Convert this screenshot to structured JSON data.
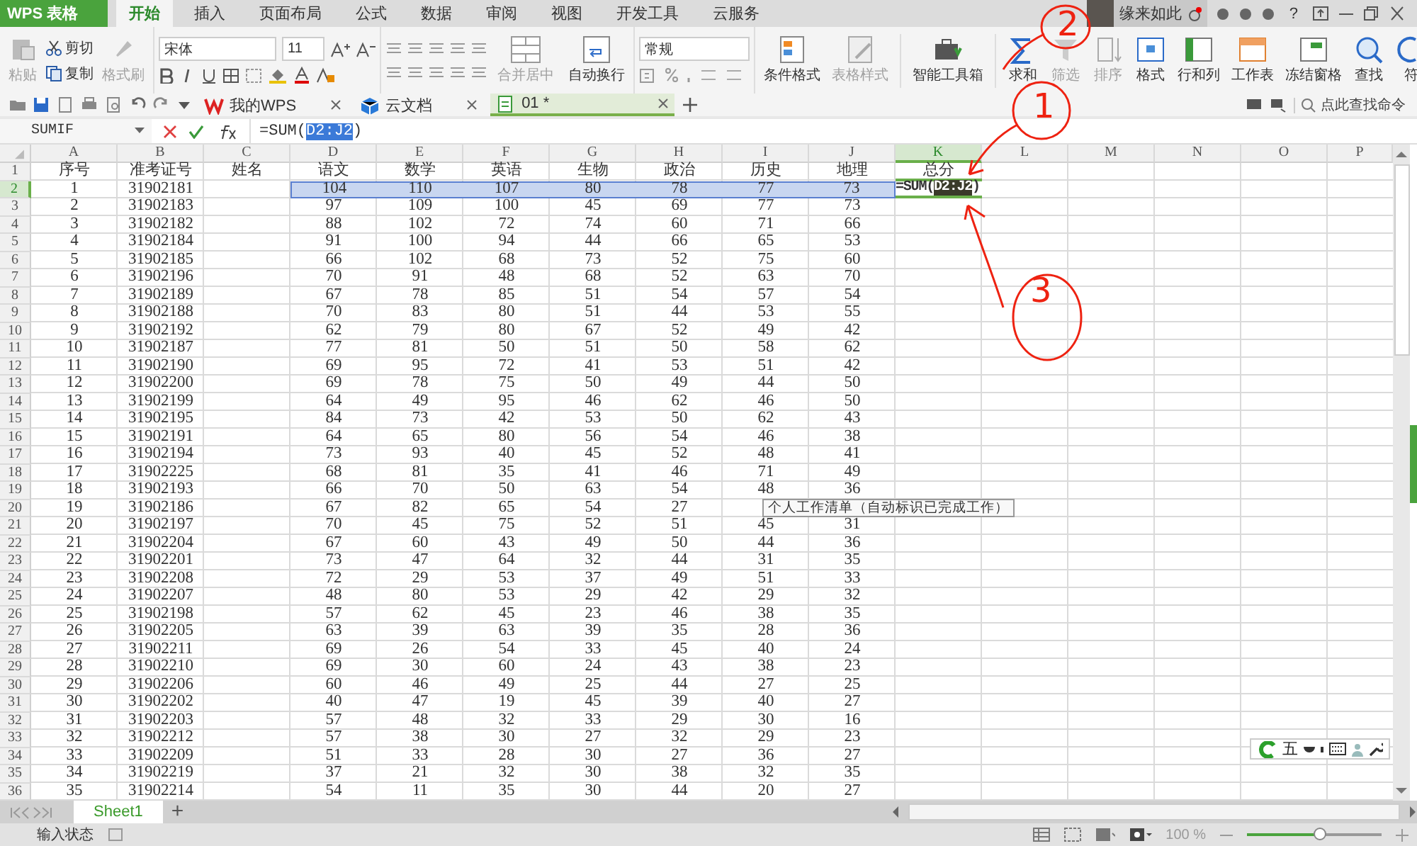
{
  "app_menu": {
    "label": "WPS 表格"
  },
  "tabs": [
    {
      "label": "开始",
      "selected": true
    },
    {
      "label": "插入",
      "selected": false
    },
    {
      "label": "页面布局",
      "selected": false
    },
    {
      "label": "公式",
      "selected": false
    },
    {
      "label": "数据",
      "selected": false
    },
    {
      "label": "审阅",
      "selected": false
    },
    {
      "label": "视图",
      "selected": false
    },
    {
      "label": "开发工具",
      "selected": false
    },
    {
      "label": "云服务",
      "selected": false
    }
  ],
  "user": {
    "name": "缘来如此",
    "help": "?"
  },
  "ribbon": {
    "clipboard": [
      {
        "label": "粘贴",
        "disabled": true
      },
      {
        "label": "剪切",
        "disabled": false
      },
      {
        "label": "复制",
        "disabled": false
      },
      {
        "label": "格式刷",
        "disabled": true
      }
    ],
    "font": {
      "name": "宋体",
      "size": "11"
    },
    "align": [
      {
        "label": "合并居中",
        "disabled": true
      },
      {
        "label": "自动换行",
        "disabled": false
      }
    ],
    "number_format": "常规",
    "big_buttons": [
      {
        "label": "条件格式",
        "disabled": false
      },
      {
        "label": "表格样式",
        "disabled": true
      },
      {
        "label": "智能工具箱",
        "disabled": false
      },
      {
        "label": "求和",
        "disabled": false
      },
      {
        "label": "筛选",
        "disabled": true
      },
      {
        "label": "排序",
        "disabled": true
      },
      {
        "label": "格式",
        "disabled": false
      },
      {
        "label": "行和列",
        "disabled": false
      },
      {
        "label": "工作表",
        "disabled": false
      },
      {
        "label": "冻结窗格",
        "disabled": false
      },
      {
        "label": "查找",
        "disabled": false
      },
      {
        "label": "符",
        "disabled": false
      }
    ]
  },
  "doc_tabs": [
    {
      "label": "我的WPS",
      "selected": false
    },
    {
      "label": "云文档",
      "selected": false
    },
    {
      "label": "01 *",
      "selected": true
    }
  ],
  "command_search": {
    "placeholder": "点此查找命令"
  },
  "formula_bar": {
    "name_box": "SUMIF",
    "formula_prefix": "=SUM(",
    "formula_ref": "D2:J2",
    "formula_suffix": ")"
  },
  "active_cell": {
    "prefix": "=SUM(",
    "ref": "D2:J2",
    "suffix": ")"
  },
  "sheet": {
    "columns": [
      {
        "label": "A",
        "selected": false
      },
      {
        "label": "B",
        "selected": false
      },
      {
        "label": "C",
        "selected": false
      },
      {
        "label": "D",
        "selected": false
      },
      {
        "label": "E",
        "selected": false
      },
      {
        "label": "F",
        "selected": false
      },
      {
        "label": "G",
        "selected": false
      },
      {
        "label": "H",
        "selected": false
      },
      {
        "label": "I",
        "selected": false
      },
      {
        "label": "J",
        "selected": false
      },
      {
        "label": "K",
        "selected": true
      },
      {
        "label": "L",
        "selected": false
      },
      {
        "label": "M",
        "selected": false
      },
      {
        "label": "N",
        "selected": false
      },
      {
        "label": "O",
        "selected": false
      },
      {
        "label": "P",
        "selected": false
      }
    ],
    "rows": [
      {
        "number": "1",
        "selected": false,
        "referenced": false,
        "cells": [
          "序号",
          "准考证号",
          "姓名",
          "语文",
          "数学",
          "英语",
          "生物",
          "政治",
          "历史",
          "地理",
          "总分"
        ]
      },
      {
        "number": "2",
        "selected": true,
        "referenced": true,
        "cells": [
          "1",
          "31902181",
          null,
          "104",
          "110",
          "107",
          "80",
          "78",
          "77",
          "73"
        ]
      },
      {
        "number": "3",
        "selected": false,
        "referenced": false,
        "cells": [
          "2",
          "31902183",
          null,
          "97",
          "109",
          "100",
          "45",
          "69",
          "77",
          "73"
        ]
      },
      {
        "number": "4",
        "selected": false,
        "referenced": false,
        "cells": [
          "3",
          "31902182",
          null,
          "88",
          "102",
          "72",
          "74",
          "60",
          "71",
          "66"
        ]
      },
      {
        "number": "5",
        "selected": false,
        "referenced": false,
        "cells": [
          "4",
          "31902184",
          null,
          "91",
          "100",
          "94",
          "44",
          "66",
          "65",
          "53"
        ]
      },
      {
        "number": "6",
        "selected": false,
        "referenced": false,
        "cells": [
          "5",
          "31902185",
          null,
          "66",
          "102",
          "68",
          "73",
          "52",
          "75",
          "60"
        ]
      },
      {
        "number": "7",
        "selected": false,
        "referenced": false,
        "cells": [
          "6",
          "31902196",
          null,
          "70",
          "91",
          "48",
          "68",
          "52",
          "63",
          "70"
        ]
      },
      {
        "number": "8",
        "selected": false,
        "referenced": false,
        "cells": [
          "7",
          "31902189",
          null,
          "67",
          "78",
          "85",
          "51",
          "54",
          "57",
          "54"
        ]
      },
      {
        "number": "9",
        "selected": false,
        "referenced": false,
        "cells": [
          "8",
          "31902188",
          null,
          "70",
          "83",
          "80",
          "51",
          "44",
          "53",
          "55"
        ]
      },
      {
        "number": "10",
        "selected": false,
        "referenced": false,
        "cells": [
          "9",
          "31902192",
          null,
          "62",
          "79",
          "80",
          "67",
          "52",
          "49",
          "42"
        ]
      },
      {
        "number": "11",
        "selected": false,
        "referenced": false,
        "cells": [
          "10",
          "31902187",
          null,
          "77",
          "81",
          "50",
          "51",
          "50",
          "58",
          "62"
        ]
      },
      {
        "number": "12",
        "selected": false,
        "referenced": false,
        "cells": [
          "11",
          "31902190",
          null,
          "69",
          "95",
          "72",
          "41",
          "53",
          "51",
          "42"
        ]
      },
      {
        "number": "13",
        "selected": false,
        "referenced": false,
        "cells": [
          "12",
          "31902200",
          null,
          "69",
          "78",
          "75",
          "50",
          "49",
          "44",
          "50"
        ]
      },
      {
        "number": "14",
        "selected": false,
        "referenced": false,
        "cells": [
          "13",
          "31902199",
          null,
          "64",
          "49",
          "95",
          "46",
          "62",
          "46",
          "50"
        ]
      },
      {
        "number": "15",
        "selected": false,
        "referenced": false,
        "cells": [
          "14",
          "31902195",
          null,
          "84",
          "73",
          "42",
          "53",
          "50",
          "62",
          "43"
        ]
      },
      {
        "number": "16",
        "selected": false,
        "referenced": false,
        "cells": [
          "15",
          "31902191",
          null,
          "64",
          "65",
          "80",
          "56",
          "54",
          "46",
          "38"
        ]
      },
      {
        "number": "17",
        "selected": false,
        "referenced": false,
        "cells": [
          "16",
          "31902194",
          null,
          "73",
          "93",
          "40",
          "45",
          "52",
          "48",
          "41"
        ]
      },
      {
        "number": "18",
        "selected": false,
        "referenced": false,
        "cells": [
          "17",
          "31902225",
          null,
          "68",
          "81",
          "35",
          "41",
          "46",
          "71",
          "49"
        ]
      },
      {
        "number": "19",
        "selected": false,
        "referenced": false,
        "cells": [
          "18",
          "31902193",
          null,
          "66",
          "70",
          "50",
          "63",
          "54",
          "48",
          "36"
        ]
      },
      {
        "number": "20",
        "selected": false,
        "referenced": false,
        "cells": [
          "19",
          "31902186",
          null,
          "67",
          "82",
          "65",
          "54",
          "27"
        ]
      },
      {
        "number": "21",
        "selected": false,
        "referenced": false,
        "cells": [
          "20",
          "31902197",
          null,
          "70",
          "45",
          "75",
          "52",
          "51",
          "45",
          "31"
        ]
      },
      {
        "number": "22",
        "selected": false,
        "referenced": false,
        "cells": [
          "21",
          "31902204",
          null,
          "67",
          "60",
          "43",
          "49",
          "50",
          "44",
          "36"
        ]
      },
      {
        "number": "23",
        "selected": false,
        "referenced": false,
        "cells": [
          "22",
          "31902201",
          null,
          "73",
          "47",
          "64",
          "32",
          "44",
          "31",
          "35"
        ]
      },
      {
        "number": "24",
        "selected": false,
        "referenced": false,
        "cells": [
          "23",
          "31902208",
          null,
          "72",
          "29",
          "53",
          "37",
          "49",
          "51",
          "33"
        ]
      },
      {
        "number": "25",
        "selected": false,
        "referenced": false,
        "cells": [
          "24",
          "31902207",
          null,
          "48",
          "80",
          "53",
          "29",
          "42",
          "29",
          "32"
        ]
      },
      {
        "number": "26",
        "selected": false,
        "referenced": false,
        "cells": [
          "25",
          "31902198",
          null,
          "57",
          "62",
          "45",
          "23",
          "46",
          "38",
          "35"
        ]
      },
      {
        "number": "27",
        "selected": false,
        "referenced": false,
        "cells": [
          "26",
          "31902205",
          null,
          "63",
          "39",
          "63",
          "39",
          "35",
          "28",
          "36"
        ]
      },
      {
        "number": "28",
        "selected": false,
        "referenced": false,
        "cells": [
          "27",
          "31902211",
          null,
          "69",
          "26",
          "54",
          "33",
          "45",
          "40",
          "24"
        ]
      },
      {
        "number": "29",
        "selected": false,
        "referenced": false,
        "cells": [
          "28",
          "31902210",
          null,
          "69",
          "30",
          "60",
          "24",
          "43",
          "38",
          "23"
        ]
      },
      {
        "number": "30",
        "selected": false,
        "referenced": false,
        "cells": [
          "29",
          "31902206",
          null,
          "60",
          "46",
          "49",
          "25",
          "44",
          "27",
          "25"
        ]
      },
      {
        "number": "31",
        "selected": false,
        "referenced": false,
        "cells": [
          "30",
          "31902202",
          null,
          "40",
          "47",
          "19",
          "45",
          "39",
          "40",
          "27"
        ]
      },
      {
        "number": "32",
        "selected": false,
        "referenced": false,
        "cells": [
          "31",
          "31902203",
          null,
          "57",
          "48",
          "32",
          "33",
          "29",
          "30",
          "16"
        ]
      },
      {
        "number": "33",
        "selected": false,
        "referenced": false,
        "cells": [
          "32",
          "31902212",
          null,
          "57",
          "38",
          "30",
          "27",
          "32",
          "29",
          "23"
        ]
      },
      {
        "number": "34",
        "selected": false,
        "referenced": false,
        "cells": [
          "33",
          "31902209",
          null,
          "51",
          "33",
          "28",
          "30",
          "27",
          "36",
          "27"
        ]
      },
      {
        "number": "35",
        "selected": false,
        "referenced": false,
        "cells": [
          "34",
          "31902219",
          null,
          "37",
          "21",
          "32",
          "30",
          "38",
          "32",
          "35"
        ]
      },
      {
        "number": "36",
        "selected": false,
        "referenced": false,
        "cells": [
          "35",
          "31902214",
          null,
          "54",
          "11",
          "35",
          "30",
          "44",
          "20",
          "27"
        ]
      }
    ]
  },
  "tooltip": "个人工作清单（自动标识已完成工作）",
  "ime_bar": {
    "mode": "五"
  },
  "sheet_tabs": [
    {
      "label": "Sheet1",
      "selected": true
    }
  ],
  "add_sheet": "+",
  "status_bar": {
    "mode": "输入状态",
    "zoom": "100 %",
    "zoom_slider": {
      "level": 0.55
    }
  },
  "annotations": [
    {
      "label": "1"
    },
    {
      "label": "2"
    },
    {
      "label": "3"
    }
  ]
}
